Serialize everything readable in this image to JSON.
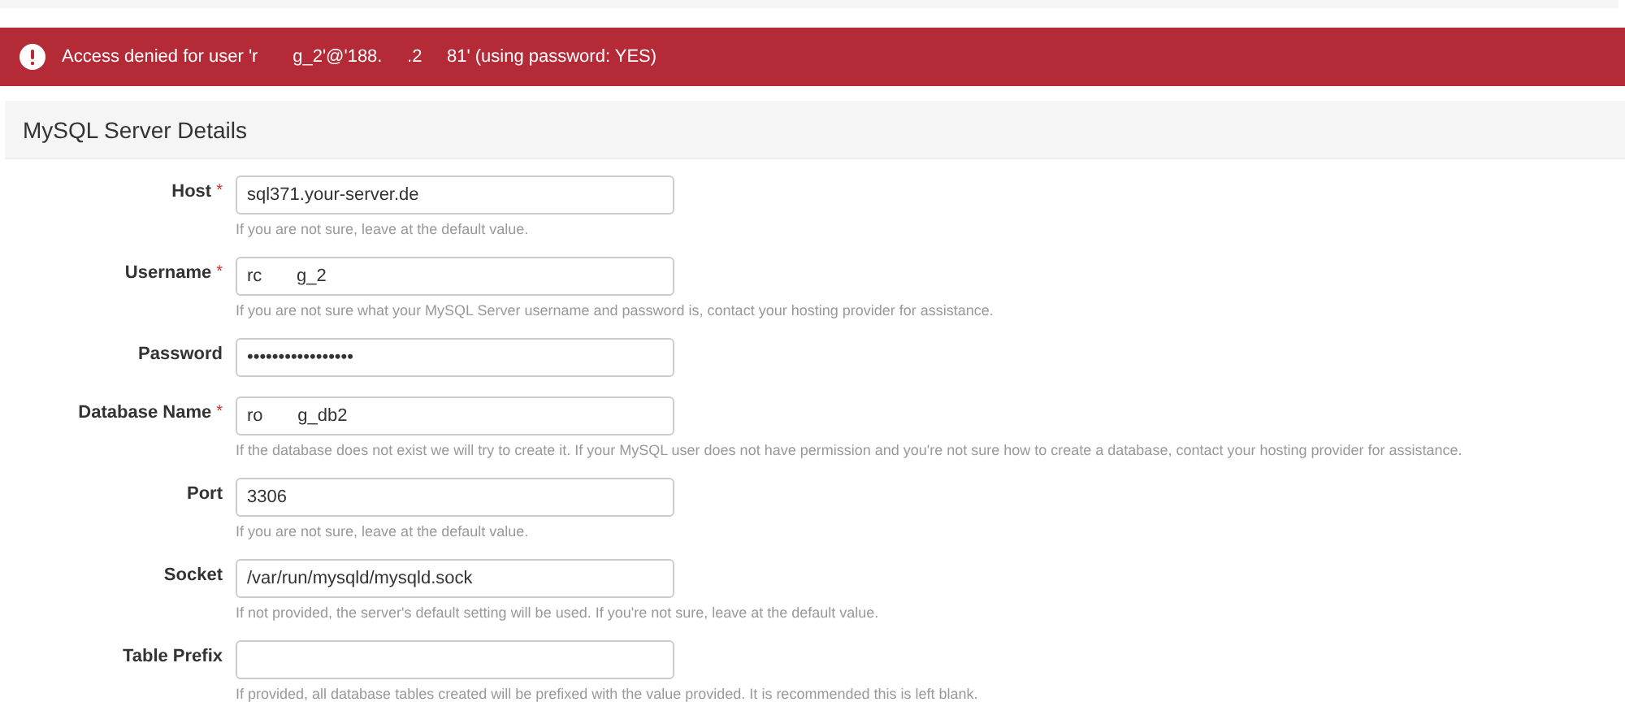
{
  "alert": {
    "message": "Access denied for user 'r       g_2'@'188.     .2     81' (using password: YES)"
  },
  "panel": {
    "title": "MySQL Server Details"
  },
  "fields": [
    {
      "label": "Host",
      "required_mark": "*",
      "value": "sql371.your-server.de",
      "help": "If you are not sure, leave at the default value."
    },
    {
      "label": "Username",
      "required_mark": "*",
      "value": "rc       g_2",
      "help": "If you are not sure what your MySQL Server username and password is, contact your hosting provider for assistance."
    },
    {
      "label": "Password",
      "value": "•••••••••••••••••"
    },
    {
      "label": "Database Name",
      "required_mark": "*",
      "value": "ro       g_db2",
      "help": "If the database does not exist we will try to create it. If your MySQL user does not have permission and you're not sure how to create a database, contact your hosting provider for assistance."
    },
    {
      "label": "Port",
      "value": "3306",
      "help": "If you are not sure, leave at the default value."
    },
    {
      "label": "Socket",
      "value": "/var/run/mysqld/mysqld.sock",
      "help": "If not provided, the server's default setting will be used. If you're not sure, leave at the default value."
    },
    {
      "label": "Table Prefix",
      "help": "If provided, all database tables created will be prefixed with the value provided. It is recommended this is left blank."
    }
  ]
}
